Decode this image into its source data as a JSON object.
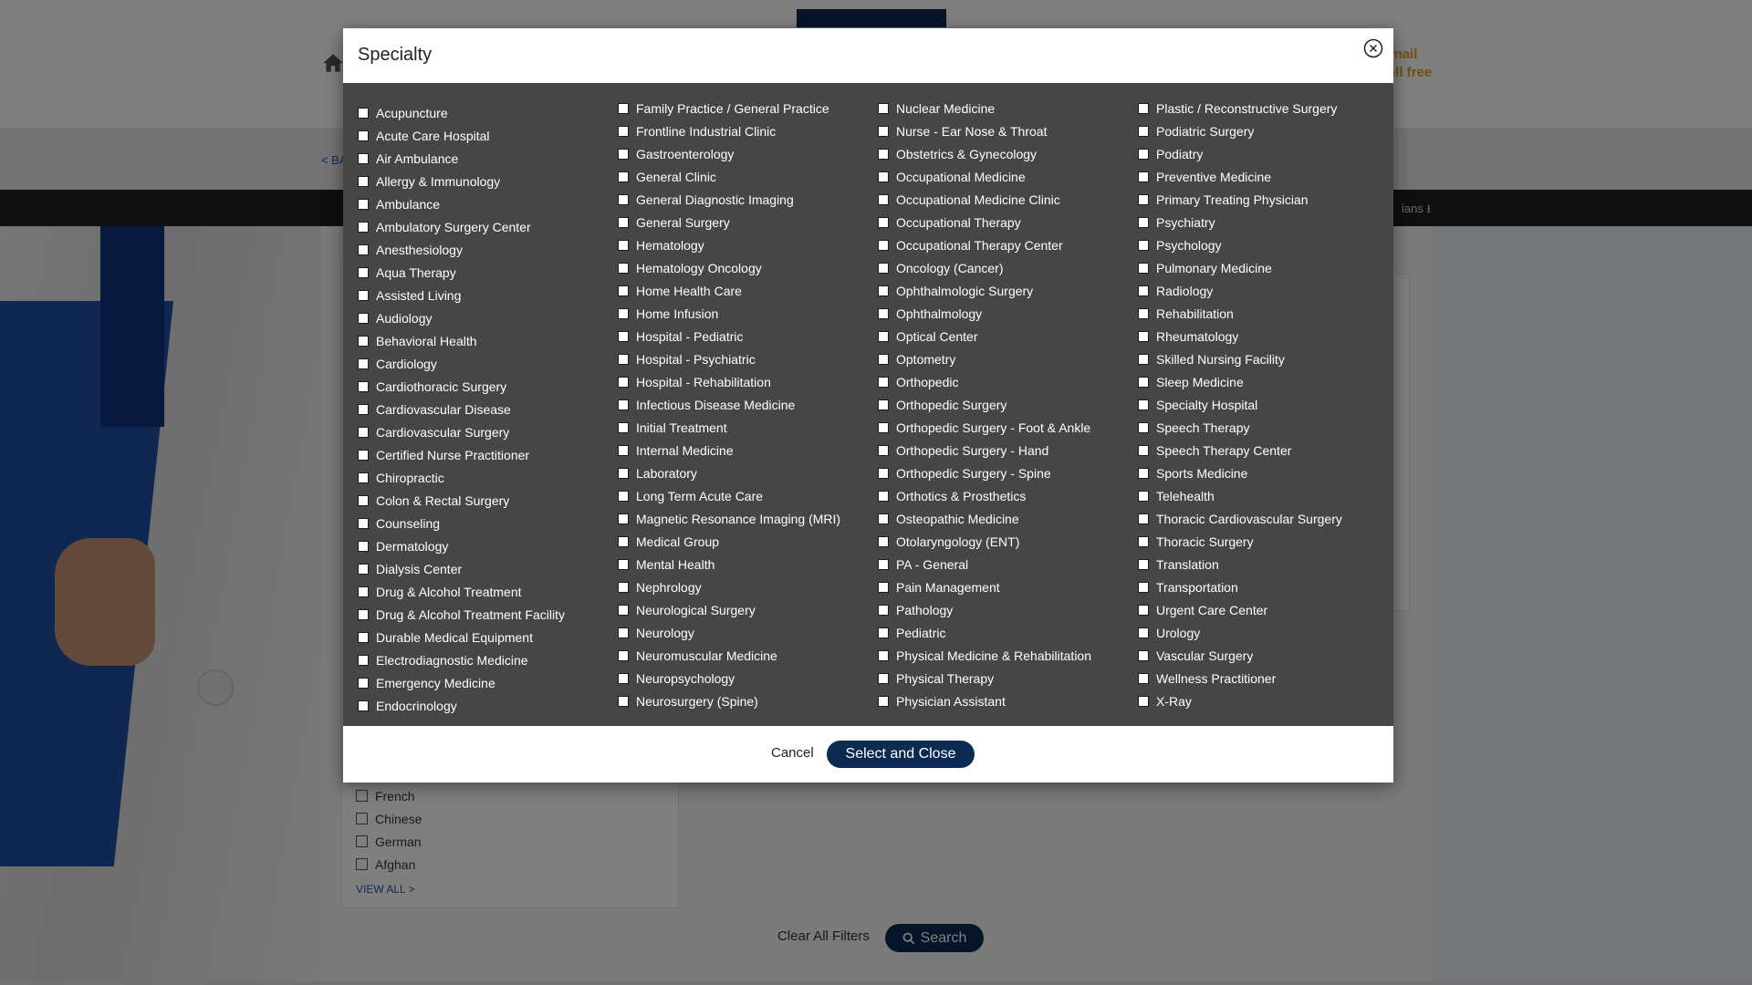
{
  "background": {
    "contact_text_line1": "email",
    "contact_text_line2": "toll free",
    "back_link": "< BACK",
    "dark_bar_text": "ians",
    "languages": [
      "French",
      "Chinese",
      "German",
      "Afghan"
    ],
    "view_all": "VIEW ALL >",
    "clear_all_filters": "Clear All Filters",
    "search_button": "Search"
  },
  "modal": {
    "title": "Specialty",
    "cancel_label": "Cancel",
    "select_close_label": "Select and Close",
    "columns": [
      [
        "Acupuncture",
        "Acute Care Hospital",
        "Air Ambulance",
        "Allergy & Immunology",
        "Ambulance",
        "Ambulatory Surgery Center",
        "Anesthesiology",
        "Aqua Therapy",
        "Assisted Living",
        "Audiology",
        "Behavioral Health",
        "Cardiology",
        "Cardiothoracic Surgery",
        "Cardiovascular Disease",
        "Cardiovascular Surgery",
        "Certified Nurse Practitioner",
        "Chiropractic",
        "Colon & Rectal Surgery",
        "Counseling",
        "Dermatology",
        "Dialysis Center",
        "Drug & Alcohol Treatment",
        "Drug & Alcohol Treatment Facility",
        "Durable Medical Equipment",
        "Electrodiagnostic Medicine",
        "Emergency Medicine",
        "Endocrinology"
      ],
      [
        "Family Practice / General Practice",
        "Frontline Industrial Clinic",
        "Gastroenterology",
        "General Clinic",
        "General Diagnostic Imaging",
        "General Surgery",
        "Hematology",
        "Hematology Oncology",
        "Home Health Care",
        "Home Infusion",
        "Hospital - Pediatric",
        "Hospital - Psychiatric",
        "Hospital - Rehabilitation",
        "Infectious Disease Medicine",
        "Initial Treatment",
        "Internal Medicine",
        "Laboratory",
        "Long Term Acute Care",
        "Magnetic Resonance Imaging (MRI)",
        "Medical Group",
        "Mental Health",
        "Nephrology",
        "Neurological Surgery",
        "Neurology",
        "Neuromuscular Medicine",
        "Neuropsychology",
        "Neurosurgery (Spine)"
      ],
      [
        "Nuclear Medicine",
        "Nurse - Ear Nose & Throat",
        "Obstetrics & Gynecology",
        "Occupational Medicine",
        "Occupational Medicine Clinic",
        "Occupational Therapy",
        "Occupational Therapy Center",
        "Oncology (Cancer)",
        "Ophthalmologic Surgery",
        "Ophthalmology",
        "Optical Center",
        "Optometry",
        "Orthopedic",
        "Orthopedic Surgery",
        "Orthopedic Surgery - Foot & Ankle",
        "Orthopedic Surgery - Hand",
        "Orthopedic Surgery - Spine",
        "Orthotics & Prosthetics",
        "Osteopathic Medicine",
        "Otolaryngology (ENT)",
        "PA - General",
        "Pain Management",
        "Pathology",
        "Pediatric",
        "Physical Medicine & Rehabilitation",
        "Physical Therapy",
        "Physician Assistant"
      ],
      [
        "Plastic / Reconstructive Surgery",
        "Podiatric Surgery",
        "Podiatry",
        "Preventive Medicine",
        "Primary Treating Physician",
        "Psychiatry",
        "Psychology",
        "Pulmonary Medicine",
        "Radiology",
        "Rehabilitation",
        "Rheumatology",
        "Skilled Nursing Facility",
        "Sleep Medicine",
        "Specialty Hospital",
        "Speech Therapy",
        "Speech Therapy Center",
        "Sports Medicine",
        "Telehealth",
        "Thoracic Cardiovascular Surgery",
        "Thoracic Surgery",
        "Translation",
        "Transportation",
        "Urgent Care Center",
        "Urology",
        "Vascular Surgery",
        "Wellness Practitioner",
        "X-Ray"
      ]
    ]
  },
  "colors": {
    "brand_navy": "#0d2b52",
    "modal_body": "#464646"
  }
}
